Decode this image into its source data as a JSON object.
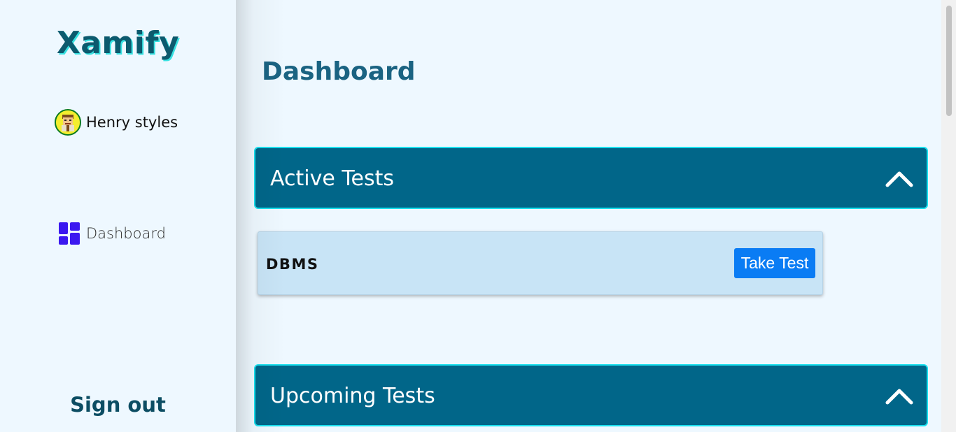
{
  "sidebar": {
    "brand": "Xamify",
    "user": {
      "name": "Henry styles",
      "avatar_icon": "avatar-icon"
    },
    "nav": [
      {
        "label": "Dashboard",
        "icon": "dashboard-icon"
      }
    ],
    "signout_label": "Sign out"
  },
  "main": {
    "title": "Dashboard",
    "sections": [
      {
        "title": "Active Tests",
        "expanded": true,
        "icon": "chevron-up-icon"
      },
      {
        "title": "Upcoming Tests",
        "expanded": true,
        "icon": "chevron-up-icon"
      }
    ],
    "active_tests": [
      {
        "name": "DBMS",
        "action_label": "Take Test"
      }
    ]
  },
  "colors": {
    "background": "#eef8ff",
    "brand": "#0c5a6e",
    "brand_shadow": "#37e1e1",
    "header_bg": "#016689",
    "header_border": "#19e0ee",
    "card_bg": "#c8e4f6",
    "button_bg": "#0a7cf4",
    "nav_icon": "#3b18f0"
  }
}
